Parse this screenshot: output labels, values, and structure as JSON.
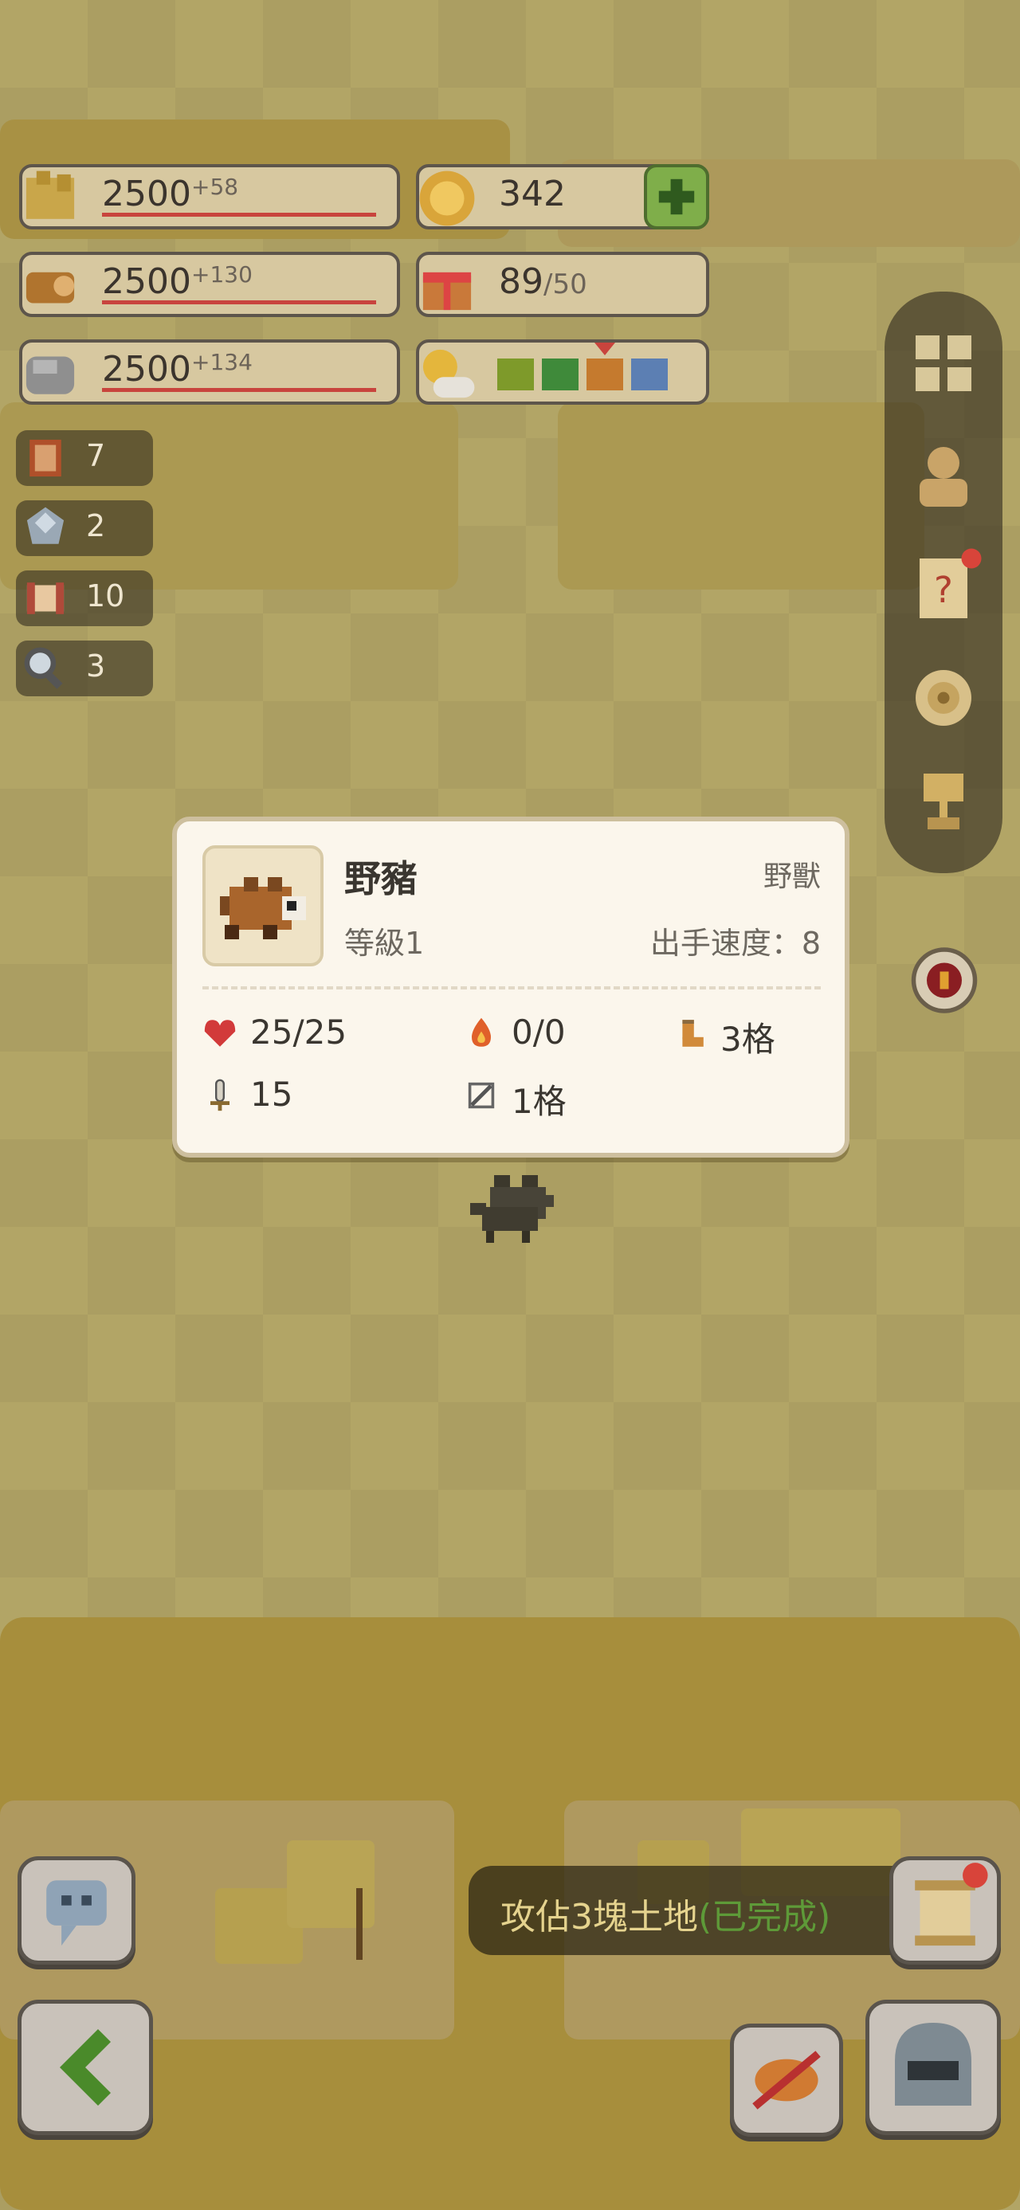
{
  "resources": [
    {
      "name": "wheat",
      "value": "2500",
      "increment": "+58"
    },
    {
      "name": "wood",
      "value": "2500",
      "increment": "+130"
    },
    {
      "name": "stone",
      "value": "2500",
      "increment": "+134"
    }
  ],
  "currency": {
    "gold": "342",
    "gift_value": "89",
    "gift_max": "/50"
  },
  "weather": {
    "icon": "weather-sun-cloud-icon",
    "season_colors": [
      "#7e9a2a",
      "#3f8a3a",
      "#c57a2e",
      "#5c7fb3"
    ]
  },
  "items": [
    {
      "icon": "book-icon",
      "count": "7"
    },
    {
      "icon": "ore-icon",
      "count": "2"
    },
    {
      "icon": "scroll-icon",
      "count": "10"
    },
    {
      "icon": "magnifier-icon",
      "count": "3"
    }
  ],
  "sidebar": [
    "grid-menu-icon",
    "character-icon",
    "quest-scroll-icon",
    "target-icon",
    "trophy-icon"
  ],
  "popup": {
    "name": "野豬",
    "type": "野獸",
    "level": "等級1",
    "speed": "出手速度：8",
    "hp": "25/25",
    "fire": "0/0",
    "move": "3格",
    "attack": "15",
    "range": "1格"
  },
  "quest": {
    "text": "攻佔3塊土地",
    "status": "(已完成)"
  },
  "colors": {
    "popup_bg": "#fbf6ec",
    "quest_done": "#5e9a38",
    "hp_red": "#c8443d"
  }
}
